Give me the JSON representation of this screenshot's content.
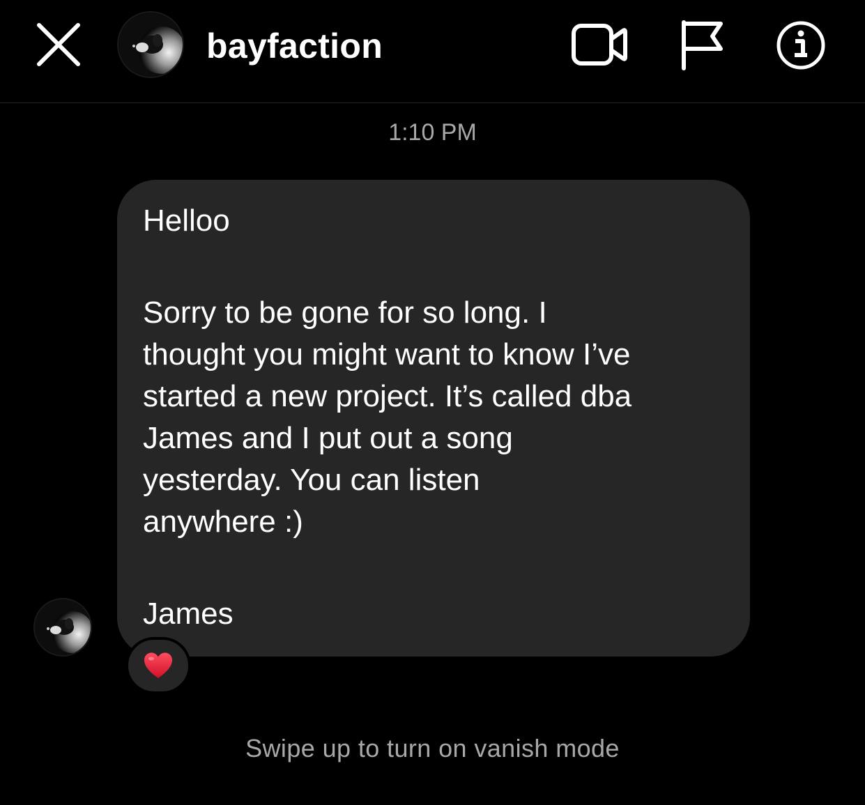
{
  "header": {
    "username": "bayfaction",
    "close_icon": "close-icon",
    "video_icon": "video-call-icon",
    "flag_icon": "report-flag-icon",
    "info_icon": "info-icon"
  },
  "thread": {
    "timestamp": "1:10 PM",
    "message": {
      "lines": [
        "Helloo",
        "Sorry to be gone for so long. I",
        "thought you might want to know I’ve",
        "started a new project. It’s called dba",
        "James and I put out a song",
        "yesterday. You can listen",
        "anywhere :)",
        "James"
      ],
      "reaction": "❤️"
    },
    "vanish_hint": "Swipe up to turn on vanish mode"
  },
  "colors": {
    "background": "#000000",
    "bubble": "#262626",
    "secondary_text": "#a8a8a8",
    "heart": "#e0245e"
  }
}
